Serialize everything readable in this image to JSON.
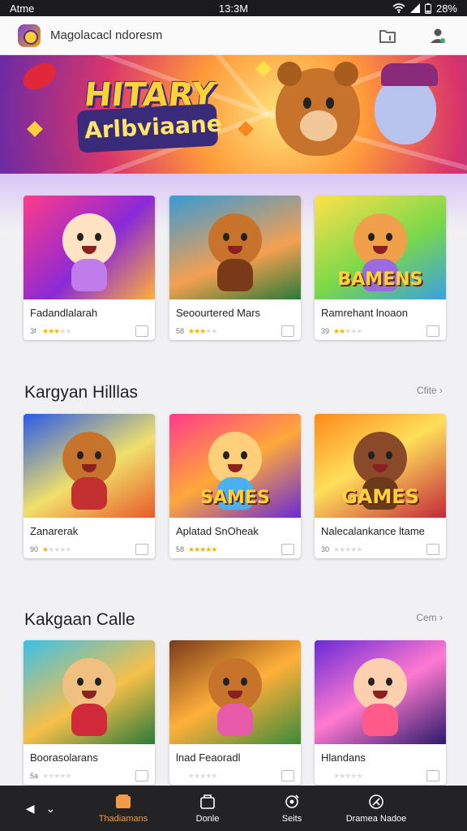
{
  "status_bar": {
    "left": "Atme",
    "time": "13:3M",
    "battery": "28%"
  },
  "app_bar": {
    "title": "Magolacacl ndoresm",
    "icons": [
      "folder-icon",
      "person-icon"
    ]
  },
  "banner": {
    "title_line1": "HITARY",
    "title_line2": "Arlbviaane"
  },
  "sections": [
    {
      "title": "",
      "more": "",
      "cards": [
        {
          "name": "Fadandlalarah",
          "score": "3f",
          "stars": 3,
          "art_text": ""
        },
        {
          "name": "Seoourtered Mars",
          "score": "58",
          "stars": 3,
          "art_text": ""
        },
        {
          "name": "Ramrehant lnoaon",
          "score": "39",
          "stars": 2,
          "art_text": "BAMENS"
        }
      ]
    },
    {
      "title": "Kargyan Hilllas",
      "more": "Cfite",
      "cards": [
        {
          "name": "Zanarerak",
          "score": "90",
          "stars": 1,
          "art_text": ""
        },
        {
          "name": "Aplatad SnOheak",
          "score": "58",
          "stars": 5,
          "art_text": "SAMES"
        },
        {
          "name": "Nalecalankance ltame",
          "score": "30",
          "stars": 0,
          "art_text": "GAMES"
        }
      ]
    },
    {
      "title": "Kakgaan Calle",
      "more": "Cem",
      "cards": [
        {
          "name": "Boorasolarans",
          "score": "5a",
          "stars": 0,
          "art_text": ""
        },
        {
          "name": "lnad Feaoradl",
          "score": "",
          "stars": 0,
          "art_text": ""
        },
        {
          "name": "Hlandans",
          "score": "",
          "stars": 0,
          "art_text": ""
        }
      ]
    }
  ],
  "bottom_nav": {
    "back_glyph": "◀",
    "menu_glyph": "⌄",
    "items": [
      {
        "label": "Thadiamans",
        "active": true
      },
      {
        "label": "Donle",
        "active": false
      },
      {
        "label": "Seits",
        "active": false
      },
      {
        "label": "Dramea Nadoe",
        "active": false
      }
    ]
  },
  "colors": {
    "accent": "#f2994a",
    "star": "#f4b400",
    "status_bar": "#1b1b1d",
    "nav_bar": "#232325"
  }
}
